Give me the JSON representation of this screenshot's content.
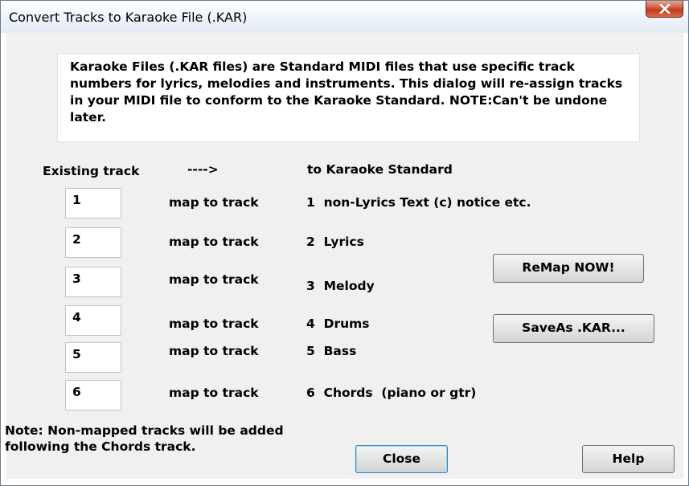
{
  "window": {
    "title": "Convert Tracks to Karaoke File (.KAR)"
  },
  "description": "Karaoke Files (.KAR files) are Standard MIDI files that use specific track numbers for lyrics, melodies and instruments. This dialog will re-assign tracks in your MIDI file to conform to the Karaoke Standard. NOTE:Can't be undone later.",
  "headers": {
    "existing": "Existing track",
    "arrow": "---->",
    "standard": "to Karaoke Standard"
  },
  "rows": [
    {
      "value": "1",
      "map": "map to track",
      "target": "1  non-Lyrics Text (c) notice etc."
    },
    {
      "value": "2",
      "map": "map to track",
      "target": "2  Lyrics"
    },
    {
      "value": "3",
      "map": "map to track",
      "target": "3  Melody"
    },
    {
      "value": "4",
      "map": "map to track",
      "target": "4  Drums"
    },
    {
      "value": "5",
      "map": "map to track",
      "target": "5  Bass"
    },
    {
      "value": "6",
      "map": "map to track",
      "target": "6  Chords  (piano or gtr)"
    }
  ],
  "buttons": {
    "remap": "ReMap NOW!",
    "saveas": "SaveAs .KAR...",
    "close": "Close",
    "help": "Help"
  },
  "note": {
    "line1": "Note: Non-mapped tracks will be added",
    "line2": "following the Chords track."
  }
}
